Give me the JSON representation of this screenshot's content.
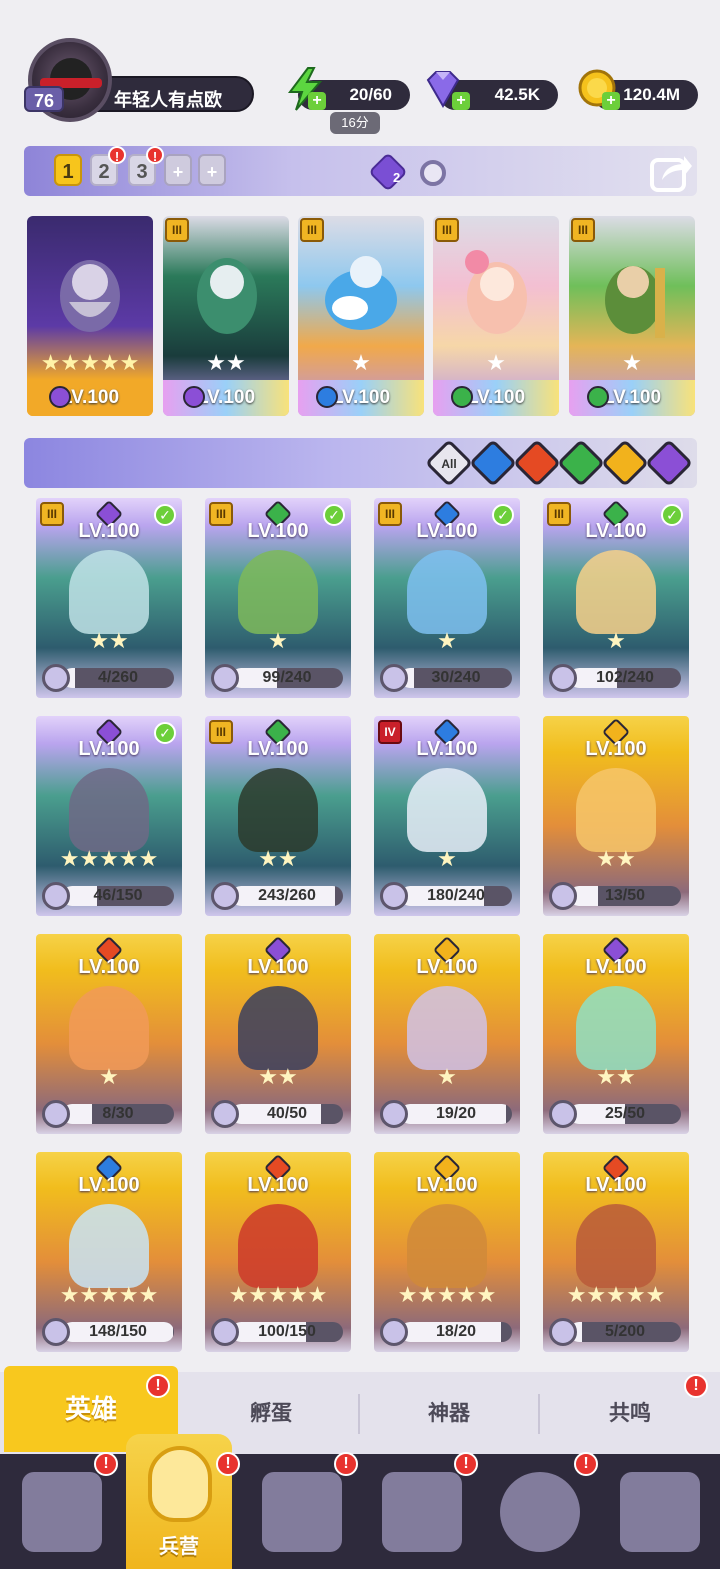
{
  "player": {
    "level": "76",
    "name": "年轻人有点欧"
  },
  "resources": {
    "energy": "20/60",
    "energy_timer": "16分",
    "gems": "42.5K",
    "gold": "120.4M"
  },
  "team_bar": {
    "slots": [
      "1",
      "2",
      "3",
      "+",
      "+"
    ],
    "crystal_count": "2"
  },
  "team_row": [
    {
      "level": "LV.100",
      "stars": "★★★★★",
      "tier": ""
    },
    {
      "level": "LV.100",
      "stars": "★★",
      "tier": "III"
    },
    {
      "level": "LV.100",
      "stars": "★",
      "tier": "III"
    },
    {
      "level": "LV.100",
      "stars": "★",
      "tier": "III"
    },
    {
      "level": "LV.100",
      "stars": "★",
      "tier": "III"
    }
  ],
  "filters": {
    "all_label": "All",
    "elements": [
      "water-icon",
      "fire-icon",
      "nature-icon",
      "light-icon",
      "dark-icon"
    ]
  },
  "heroes": [
    {
      "level": "LV.100",
      "fragments": "4/260",
      "progress": 0.015,
      "stars": "★★",
      "tier": "III",
      "checked": true,
      "element": "dark"
    },
    {
      "level": "LV.100",
      "fragments": "99/240",
      "progress": 0.41,
      "stars": "★",
      "tier": "III",
      "checked": true,
      "element": "nature"
    },
    {
      "level": "LV.100",
      "fragments": "30/240",
      "progress": 0.125,
      "stars": "★",
      "tier": "III",
      "checked": true,
      "element": "water"
    },
    {
      "level": "LV.100",
      "fragments": "102/240",
      "progress": 0.425,
      "stars": "★",
      "tier": "III",
      "checked": true,
      "element": "nature"
    },
    {
      "level": "LV.100",
      "fragments": "46/150",
      "progress": 0.31,
      "stars": "★★★★★",
      "tier": "",
      "checked": true,
      "element": "dark"
    },
    {
      "level": "LV.100",
      "fragments": "243/260",
      "progress": 0.93,
      "stars": "★★",
      "tier": "III",
      "checked": false,
      "element": "nature"
    },
    {
      "level": "LV.100",
      "fragments": "180/240",
      "progress": 0.75,
      "stars": "★",
      "tier": "IV",
      "checked": false,
      "element": "water"
    },
    {
      "level": "LV.100",
      "fragments": "13/50",
      "progress": 0.26,
      "stars": "★★",
      "tier": "",
      "checked": false,
      "element": "light"
    },
    {
      "level": "LV.100",
      "fragments": "8/30",
      "progress": 0.27,
      "stars": "★",
      "tier": "",
      "checked": false,
      "element": "fire"
    },
    {
      "level": "LV.100",
      "fragments": "40/50",
      "progress": 0.8,
      "stars": "★★",
      "tier": "",
      "checked": false,
      "element": "dark"
    },
    {
      "level": "LV.100",
      "fragments": "19/20",
      "progress": 0.95,
      "stars": "★",
      "tier": "",
      "checked": false,
      "element": "light"
    },
    {
      "level": "LV.100",
      "fragments": "25/50",
      "progress": 0.5,
      "stars": "★★",
      "tier": "",
      "checked": false,
      "element": "dark"
    },
    {
      "level": "LV.100",
      "fragments": "148/150",
      "progress": 0.99,
      "stars": "★★★★★",
      "tier": "",
      "checked": false,
      "element": "water"
    },
    {
      "level": "LV.100",
      "fragments": "100/150",
      "progress": 0.67,
      "stars": "★★★★★",
      "tier": "",
      "checked": false,
      "element": "fire"
    },
    {
      "level": "LV.100",
      "fragments": "18/20",
      "progress": 0.9,
      "stars": "★★★★★",
      "tier": "",
      "checked": false,
      "element": "light"
    },
    {
      "level": "LV.100",
      "fragments": "5/200",
      "progress": 0.025,
      "stars": "★★★★★",
      "tier": "",
      "checked": false,
      "element": "fire"
    }
  ],
  "subtabs": {
    "active": "英雄",
    "items": [
      "孵蛋",
      "神器",
      "共鸣"
    ]
  },
  "bottom_nav": {
    "active_label": "兵营"
  },
  "colors": {
    "gold_card": "#f2c320",
    "purple_card": "#a088e0",
    "fire": "#e54a23",
    "water": "#2d7de0",
    "nature": "#3bb24a",
    "light": "#f2b21c",
    "dark": "#8b4fd6"
  }
}
